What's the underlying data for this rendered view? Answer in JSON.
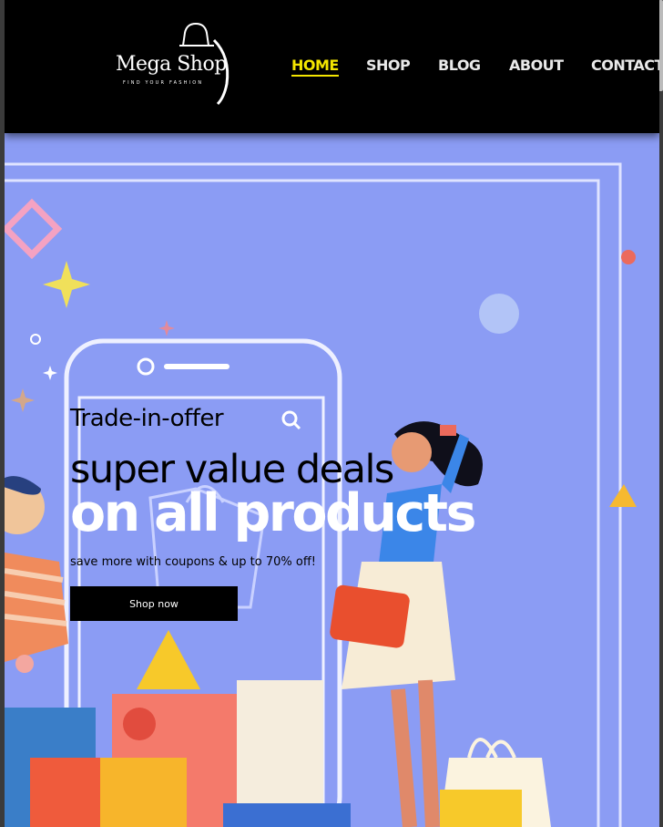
{
  "brand": {
    "name": "Mega Shop",
    "tagline": "FIND YOUR FASHION"
  },
  "nav": {
    "items": [
      {
        "label": "HOME",
        "active": true
      },
      {
        "label": "SHOP",
        "active": false
      },
      {
        "label": "BLOG",
        "active": false
      },
      {
        "label": "ABOUT",
        "active": false
      },
      {
        "label": "CONTACT",
        "active": false
      }
    ]
  },
  "hero": {
    "pretitle": "Trade-in-offer",
    "title_line1": "super value deals",
    "title_line2": "on all products",
    "subtitle": "save more with coupons & up to 70% off!",
    "cta_label": "Shop now"
  },
  "colors": {
    "header_bg": "#000000",
    "hero_bg": "#8b9cf4",
    "nav_active": "#f4e600",
    "nav_text": "#e9e9e9",
    "cta_bg": "#000000"
  },
  "icons": [
    "shopping-bag-logo-icon",
    "search-icon",
    "sparkle-icon",
    "diamond-icon"
  ]
}
